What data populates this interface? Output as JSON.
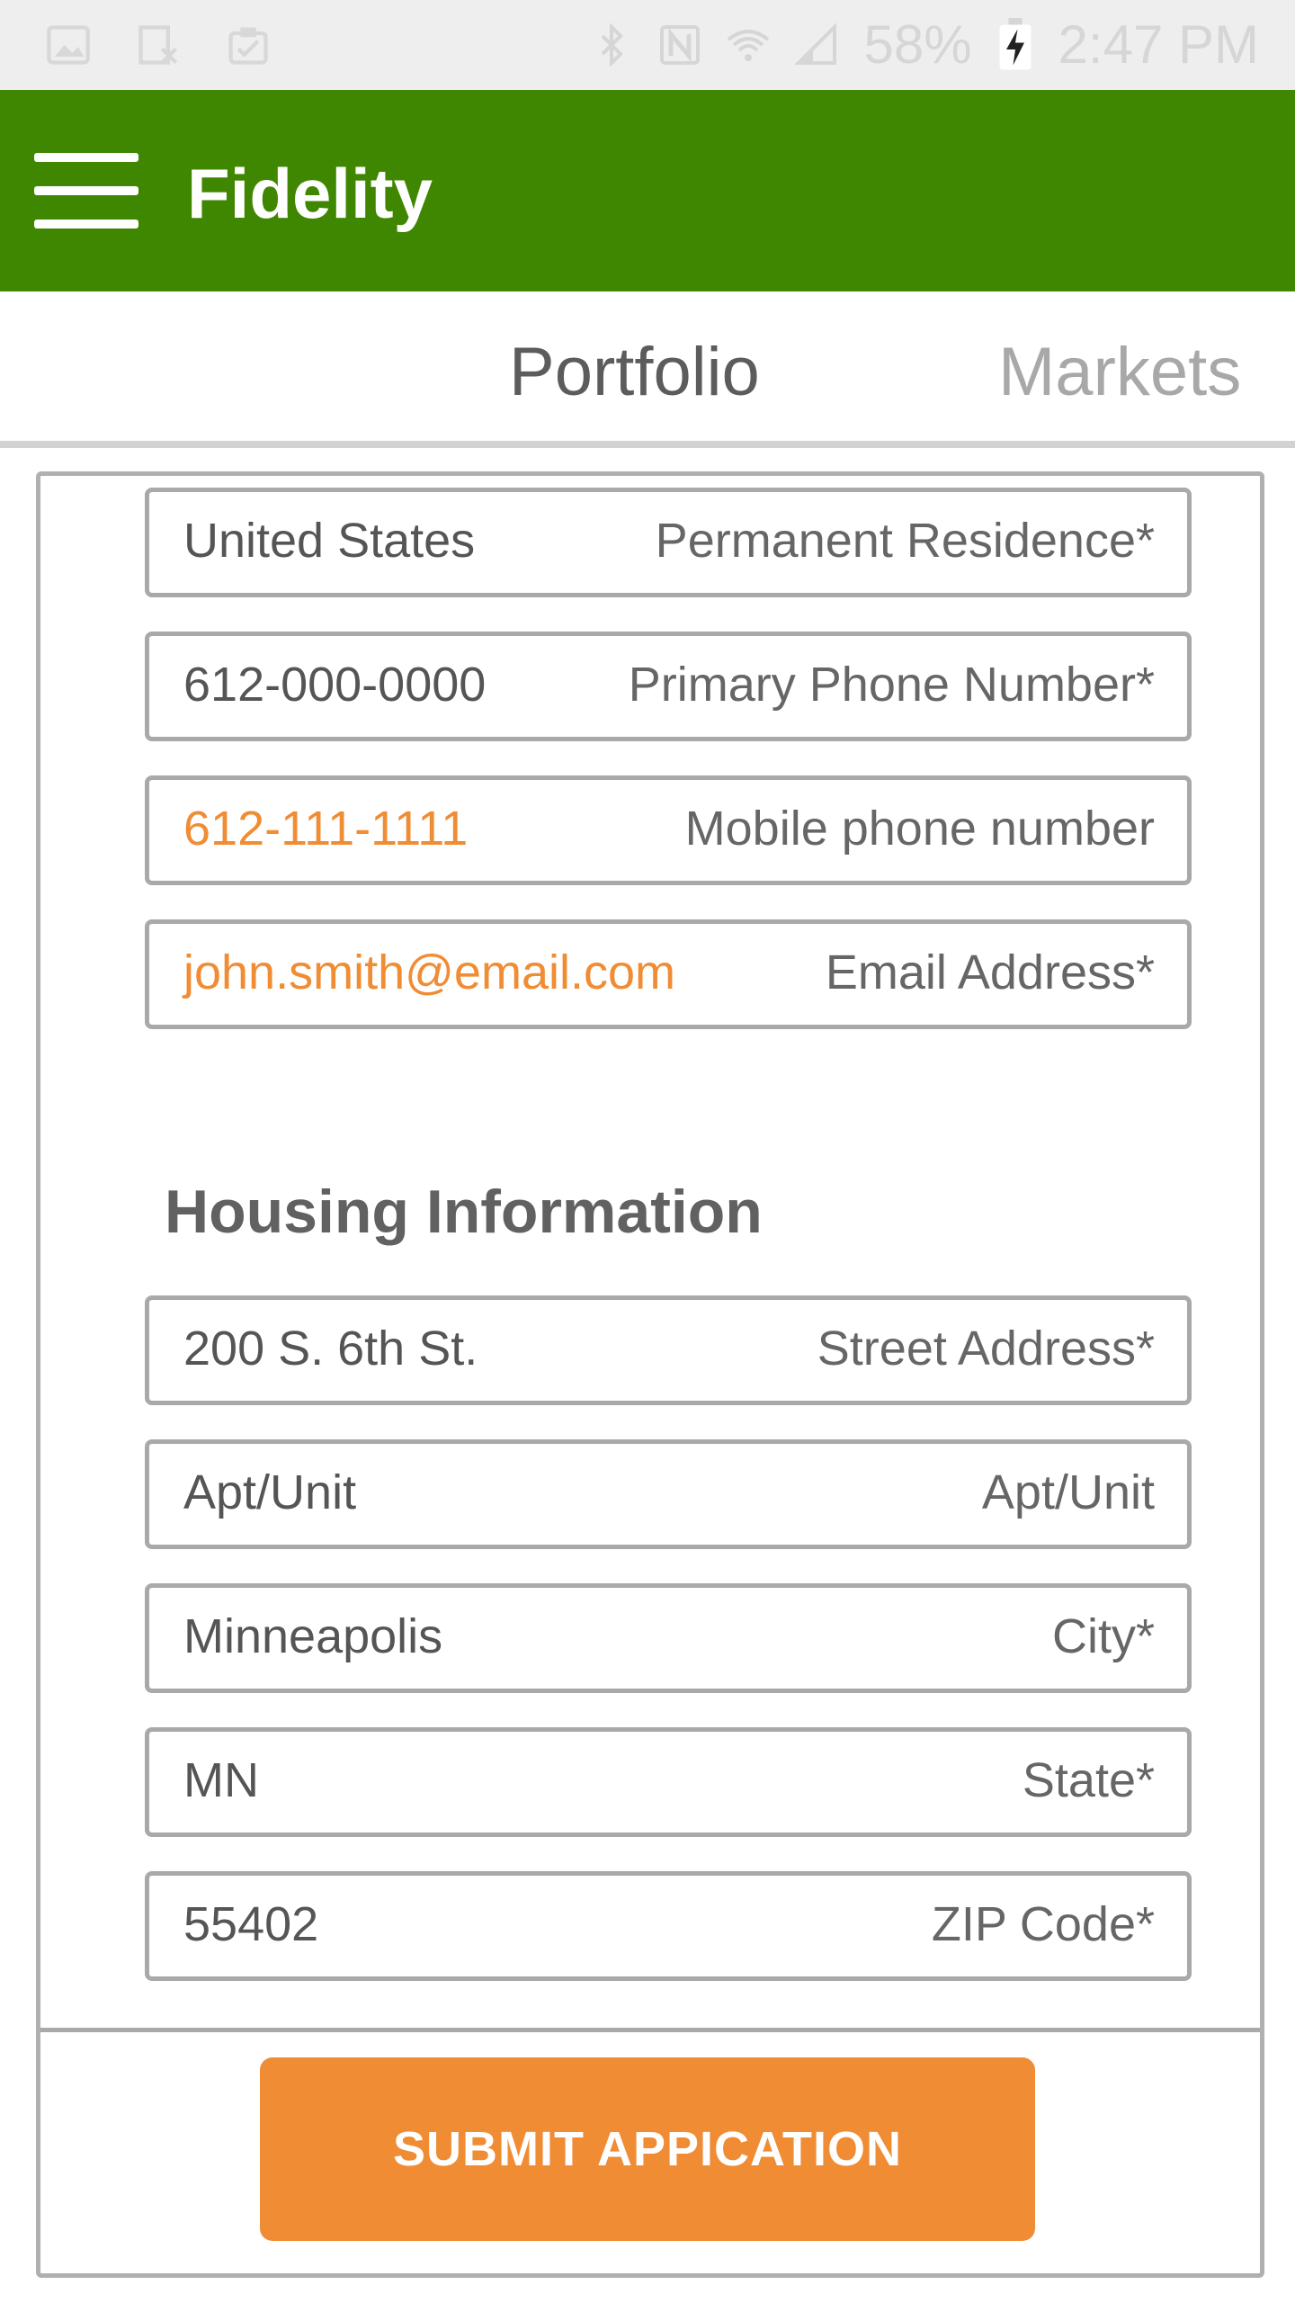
{
  "status_bar": {
    "battery_percent": "58%",
    "time": "2:47 PM",
    "icons": [
      "image-icon",
      "data-saver-icon",
      "clipboard-check-icon",
      "bluetooth-icon",
      "nfc-icon",
      "wifi-icon",
      "signal-icon",
      "battery-charging-icon"
    ]
  },
  "app_bar": {
    "title": "Fidelity",
    "background_color": "#3f8700"
  },
  "tabs": [
    {
      "label": "Portfolio",
      "selected": true
    },
    {
      "label": "Markets",
      "selected": false
    }
  ],
  "form": {
    "contact_fields": [
      {
        "value": "United States",
        "label": "Permanent Residence*"
      },
      {
        "value": "612-000-0000",
        "label": "Primary Phone Number*"
      },
      {
        "value": "612-111-1111",
        "label": "Mobile phone number"
      },
      {
        "value": "john.smith@email.com",
        "label": "Email Address*"
      }
    ],
    "housing_title": "Housing Information",
    "housing_fields": [
      {
        "value": "200 S. 6th St.",
        "label": "Street Address*"
      },
      {
        "value": "Apt/Unit",
        "label": "Apt/Unit"
      },
      {
        "value": "Minneapolis",
        "label": "City*"
      },
      {
        "value": "MN",
        "label": "State*"
      },
      {
        "value": "55402",
        "label": "ZIP Code*"
      }
    ],
    "submit_label": "SUBMIT APPICATION",
    "accent_color": "#f08c33"
  }
}
